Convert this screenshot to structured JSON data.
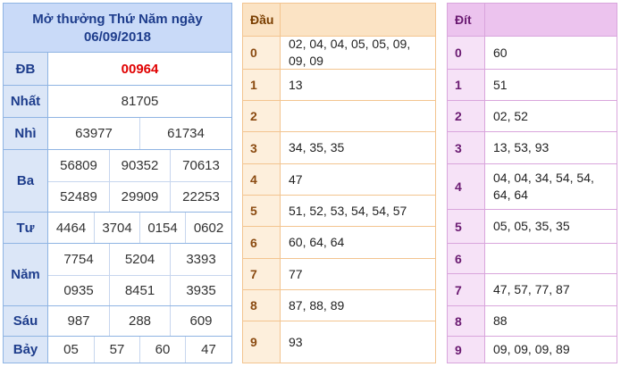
{
  "results": {
    "title_line1": "Mở thưởng Thứ Năm ngày",
    "title_line2": "06/09/2018",
    "db": {
      "label": "ĐB",
      "value": "00964"
    },
    "nhat": {
      "label": "Nhất",
      "value": "81705"
    },
    "nhi": {
      "label": "Nhì",
      "values": [
        "63977",
        "61734"
      ]
    },
    "ba": {
      "label": "Ba",
      "values": [
        "56809",
        "90352",
        "70613",
        "52489",
        "29909",
        "22253"
      ]
    },
    "tu": {
      "label": "Tư",
      "values": [
        "4464",
        "3704",
        "0154",
        "0602"
      ]
    },
    "nam": {
      "label": "Năm",
      "values": [
        "7754",
        "5204",
        "3393",
        "0935",
        "8451",
        "3935"
      ]
    },
    "sau": {
      "label": "Sáu",
      "values": [
        "987",
        "288",
        "609"
      ]
    },
    "bay": {
      "label": "Bảy",
      "values": [
        "05",
        "57",
        "60",
        "47"
      ]
    }
  },
  "dau": {
    "header": "Đầu",
    "rows": [
      {
        "key": "0",
        "value": "02, 04, 04, 05, 05, 09, 09, 09"
      },
      {
        "key": "1",
        "value": "13"
      },
      {
        "key": "2",
        "value": ""
      },
      {
        "key": "3",
        "value": "34, 35, 35"
      },
      {
        "key": "4",
        "value": "47"
      },
      {
        "key": "5",
        "value": "51, 52, 53, 54, 54, 57"
      },
      {
        "key": "6",
        "value": "60, 64, 64"
      },
      {
        "key": "7",
        "value": "77"
      },
      {
        "key": "8",
        "value": "87, 88, 89"
      },
      {
        "key": "9",
        "value": "93"
      }
    ]
  },
  "dit": {
    "header": "Đít",
    "rows": [
      {
        "key": "0",
        "value": "60"
      },
      {
        "key": "1",
        "value": "51"
      },
      {
        "key": "2",
        "value": "02, 52"
      },
      {
        "key": "3",
        "value": "13, 53, 93"
      },
      {
        "key": "4",
        "value": "04, 04, 34, 54, 54, 64, 64"
      },
      {
        "key": "5",
        "value": "05, 05, 35, 35"
      },
      {
        "key": "6",
        "value": ""
      },
      {
        "key": "7",
        "value": "47, 57, 77, 87"
      },
      {
        "key": "8",
        "value": "88"
      },
      {
        "key": "9",
        "value": "09, 09, 09, 89"
      }
    ]
  },
  "colors": {
    "accent_blue": "#1e3d8c",
    "special_prize_red": "#e00000",
    "dau_border": "#f3c48f",
    "dit_border": "#d9a5dc"
  }
}
